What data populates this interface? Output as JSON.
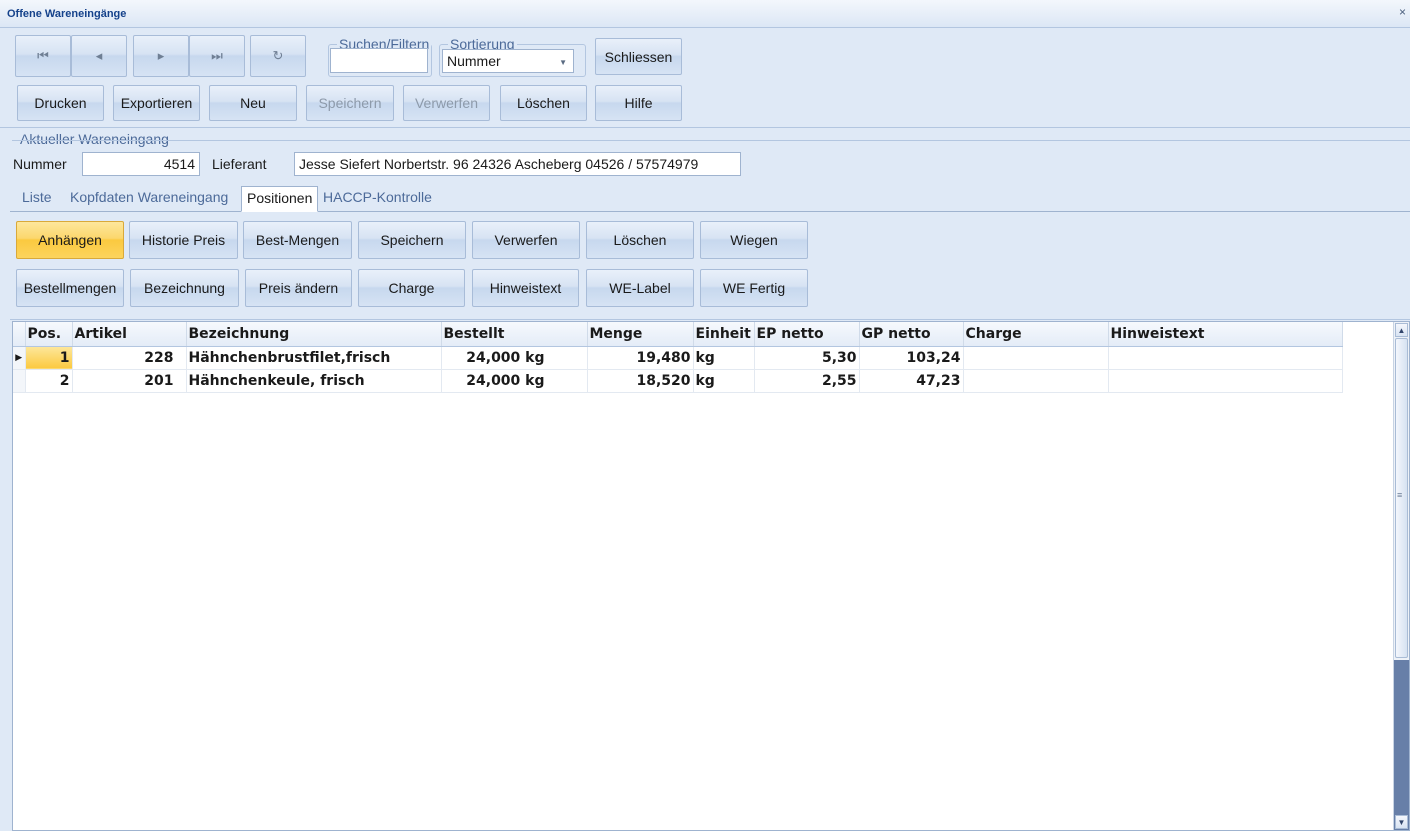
{
  "window": {
    "title": "Offene Wareneingänge",
    "close_glyph": "×"
  },
  "toolbar": {
    "nav_first_glyph": "⏮",
    "nav_prev_glyph": "◂",
    "nav_next_glyph": "▸",
    "nav_last_glyph": "⏭",
    "refresh_glyph": "↻",
    "search": {
      "label": "Suchen/Filtern",
      "value": ""
    },
    "sort": {
      "label": "Sortierung",
      "value": "Nummer"
    },
    "close_label": "Schliessen",
    "print_label": "Drucken",
    "export_label": "Exportieren",
    "new_label": "Neu",
    "save_label": "Speichern",
    "discard_label": "Verwerfen",
    "delete_label": "Löschen",
    "help_label": "Hilfe"
  },
  "current": {
    "section_label": "Aktueller Wareneingang",
    "number_label": "Nummer",
    "number_value": "4514",
    "supplier_label": "Lieferant",
    "supplier_value": "Jesse Siefert Norbertstr. 96 24326 Ascheberg 04526 / 57574979"
  },
  "tabs": [
    "Liste",
    "Kopfdaten Wareneingang",
    "Positionen",
    "HACCP-Kontrolle"
  ],
  "selected_tab": "Positionen",
  "positions_buttons": {
    "row1": [
      "Anhängen",
      "Historie Preis",
      "Best-Mengen",
      "Speichern",
      "Verwerfen",
      "Löschen",
      "Wiegen"
    ],
    "row2": [
      "Bestellmengen",
      "Bezeichnung",
      "Preis ändern",
      "Charge",
      "Hinweistext",
      "WE-Label",
      "WE Fertig"
    ]
  },
  "grid": {
    "columns": [
      "Pos.",
      "Artikel",
      "Bezeichnung",
      "Bestellt",
      "Menge",
      "Einheit",
      "EP netto",
      "GP netto",
      "Charge",
      "Hinweistext"
    ],
    "rows": [
      {
        "pos": "1",
        "artikel": "228",
        "bezeichnung": "Hähnchenbrustfilet,frisch",
        "bestellt": "24,000 kg",
        "menge": "19,480",
        "einheit": "kg",
        "ep": "5,30",
        "gp": "103,24",
        "charge": "",
        "hinweis": ""
      },
      {
        "pos": "2",
        "artikel": "201",
        "bezeichnung": "Hähnchenkeule, frisch",
        "bestellt": "24,000 kg",
        "menge": "18,520",
        "einheit": "kg",
        "ep": "2,55",
        "gp": "47,23",
        "charge": "",
        "hinweis": ""
      }
    ],
    "current_row_indicator": "▶"
  }
}
